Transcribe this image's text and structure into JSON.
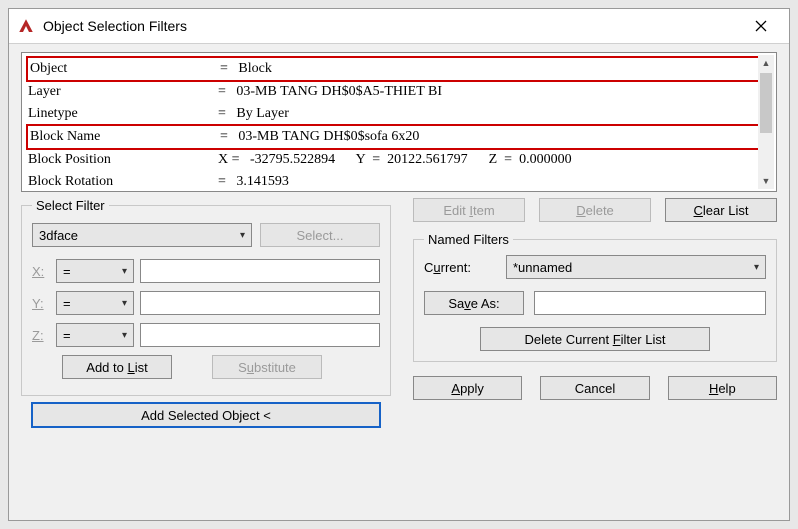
{
  "window": {
    "title": "Object Selection Filters"
  },
  "list": {
    "rows": [
      {
        "c1": "Object",
        "c2": "=   Block",
        "hl": true
      },
      {
        "c1": "Layer",
        "c2": "=   03-MB TANG DH$0$A5-THIET BI"
      },
      {
        "c1": "Linetype",
        "c2": "=   By Layer"
      },
      {
        "c1": "Block Name",
        "c2": "=   03-MB TANG DH$0$sofa 6x20",
        "hl": true
      },
      {
        "c1": "Block Position",
        "c2": "X =   -32795.522894      Y  =  20122.561797      Z  =  0.000000"
      },
      {
        "c1": "Block Rotation",
        "c2": "=   3.141593"
      }
    ]
  },
  "selectFilter": {
    "legend": "Select Filter",
    "combo": "3dface",
    "selectBtn": "Select...",
    "xLabel": "X:",
    "yLabel": "Y:",
    "zLabel": "Z:",
    "op": "=",
    "addToList": "Add to List",
    "substitute": "Substitute",
    "addSelected": "Add Selected Object <"
  },
  "rightTop": {
    "editItem": "Edit Item",
    "delete": "Delete",
    "clearList": "Clear List"
  },
  "namedFilters": {
    "legend": "Named Filters",
    "currentLabel": "Current:",
    "current": "*unnamed",
    "saveAs": "Save As:",
    "saveAsValue": "",
    "deleteCurrent": "Delete Current Filter List"
  },
  "bottom": {
    "apply": "Apply",
    "cancel": "Cancel",
    "help": "Help"
  }
}
